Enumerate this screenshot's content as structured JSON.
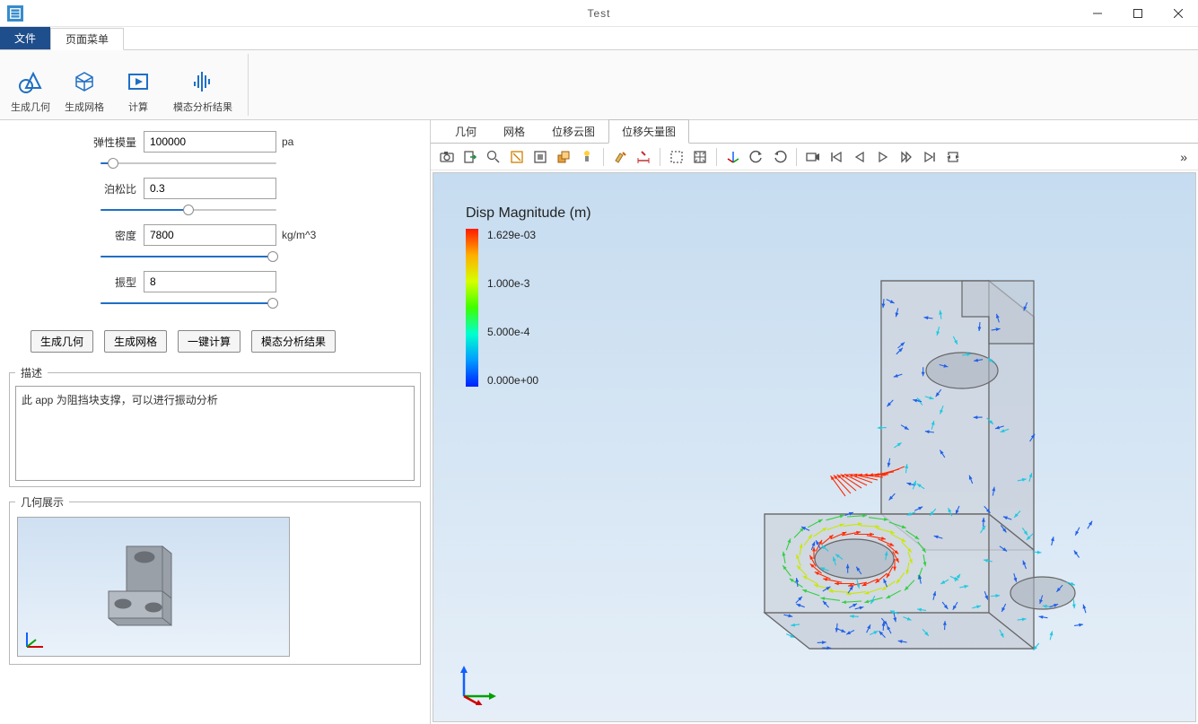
{
  "window": {
    "title": "Test"
  },
  "menu": {
    "file": "文件",
    "page_menu": "页面菜单"
  },
  "ribbon": {
    "gen_geom": "生成几何",
    "gen_mesh": "生成网格",
    "compute": "计算",
    "modal_result": "模态分析结果"
  },
  "params": {
    "elastic_label": "弹性模量",
    "elastic_value": "100000",
    "elastic_unit": "pa",
    "elastic_slider_pct": 7,
    "poisson_label": "泊松比",
    "poisson_value": "0.3",
    "poisson_slider_pct": 50,
    "density_label": "密度",
    "density_value": "7800",
    "density_unit": "kg/m^3",
    "density_slider_pct": 98,
    "mode_label": "振型",
    "mode_value": "8",
    "mode_slider_pct": 98
  },
  "buttons": {
    "gen_geom": "生成几何",
    "gen_mesh": "生成网格",
    "one_click": "一键计算",
    "modal_result": "模态分析结果"
  },
  "description": {
    "legend": "描述",
    "text": "此 app 为阻挡块支撑，可以进行振动分析"
  },
  "geom_preview": {
    "legend": "几何展示"
  },
  "view_tabs": {
    "geom": "几何",
    "mesh": "网格",
    "disp_cloud": "位移云图",
    "disp_vector": "位移矢量图"
  },
  "legend3d": {
    "title": "Disp Magnitude (m)",
    "ticks": [
      "1.629e-03",
      "1.000e-3",
      "5.000e-4",
      "0.000e+00"
    ]
  },
  "toolbar_icons": [
    "camera-icon",
    "export-icon",
    "zoom-icon",
    "select-box-icon",
    "zoom-extents-icon",
    "scene-light-icon",
    "transparency-icon",
    "sep",
    "clear-icon",
    "measure-icon",
    "sep",
    "select-rect-icon",
    "select-all-icon",
    "sep",
    "reset-view-icon",
    "rotate-left-icon",
    "rotate-right-icon",
    "sep",
    "record-icon",
    "first-frame-icon",
    "prev-frame-icon",
    "play-icon",
    "next-frame-icon",
    "last-frame-icon",
    "repeat-icon"
  ]
}
